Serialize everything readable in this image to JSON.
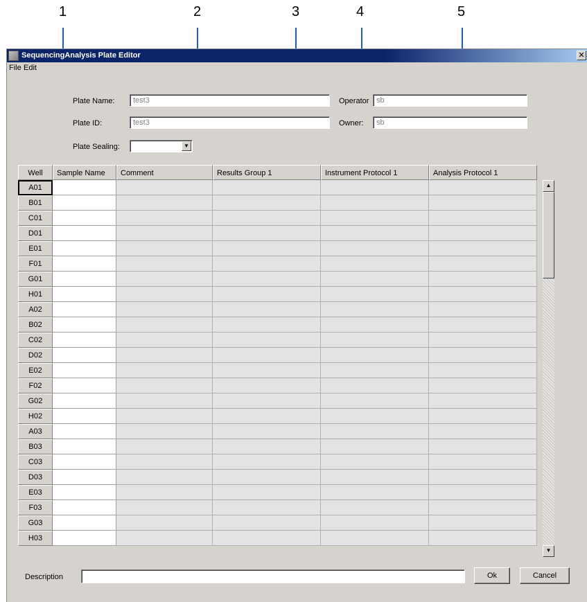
{
  "callouts": [
    "1",
    "2",
    "3",
    "4",
    "5"
  ],
  "window": {
    "title": "SequencingAnalysis Plate Editor",
    "close_symbol": "✕",
    "icon": "app-icon"
  },
  "menu": [
    "File",
    "Edit"
  ],
  "form": {
    "plate_name_label": "Plate Name:",
    "plate_name_value": "test3",
    "plate_id_label": "Plate ID:",
    "plate_id_value": "test3",
    "plate_sealing_label": "Plate Sealing:",
    "plate_sealing_value": "",
    "operator_label": "Operator",
    "operator_value": "sb",
    "owner_label": "Owner:",
    "owner_value": "sb"
  },
  "table": {
    "columns": [
      "Well",
      "Sample Name",
      "Comment",
      "Results Group 1",
      "Instrument Protocol 1",
      "Analysis Protocol 1"
    ],
    "wells": [
      "A01",
      "B01",
      "C01",
      "D01",
      "E01",
      "F01",
      "G01",
      "H01",
      "A02",
      "B02",
      "C02",
      "D02",
      "E02",
      "F02",
      "G02",
      "H02",
      "A03",
      "B03",
      "C03",
      "D03",
      "E03",
      "F03",
      "G03",
      "H03"
    ],
    "selected_well": "A01"
  },
  "scrollbar": {
    "up_icon": "scroll-up-icon",
    "down_icon": "scroll-down-icon"
  },
  "footer": {
    "description_label": "Description",
    "description_value": "",
    "ok_label": "Ok",
    "cancel_label": "Cancel"
  },
  "colors": {
    "titlebar": "#0a246a",
    "window_bg": "#d6d3ce",
    "callout_line": "#1a5fc6",
    "readonly_cell": "#e3e3e3"
  }
}
